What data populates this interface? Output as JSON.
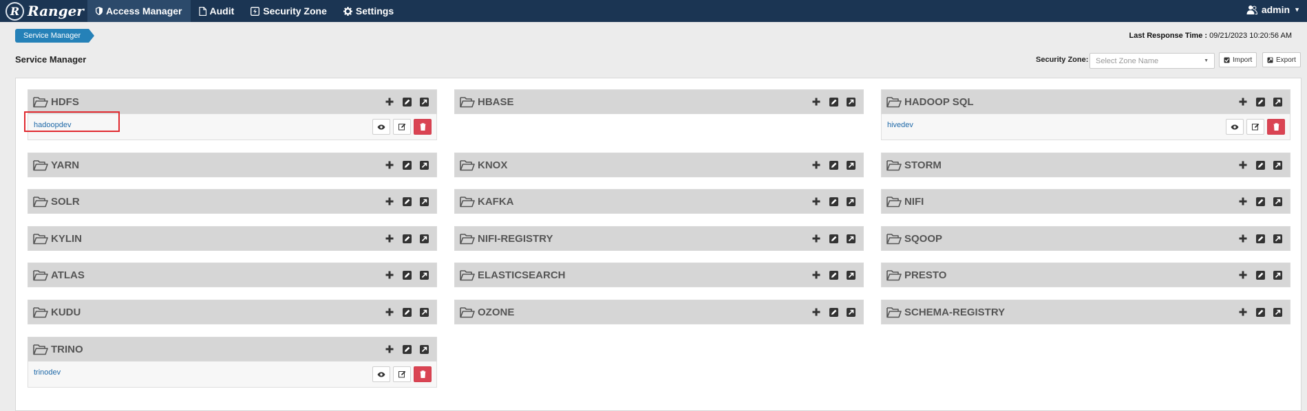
{
  "app": {
    "title": "Ranger",
    "logo_letter": "R"
  },
  "nav": [
    {
      "label": "Access Manager",
      "icon": "shield-icon",
      "active": true
    },
    {
      "label": "Audit",
      "icon": "file-icon",
      "active": false
    },
    {
      "label": "Security Zone",
      "icon": "zone-icon",
      "active": false
    },
    {
      "label": "Settings",
      "icon": "gear-icon",
      "active": false
    }
  ],
  "user": {
    "name": "admin",
    "icon": "users-icon"
  },
  "breadcrumb": "Service Manager",
  "last_response": {
    "label": "Last Response Time :",
    "value": "09/21/2023 10:20:56 AM"
  },
  "page_title": "Service Manager",
  "security_zone": {
    "label": "Security Zone:",
    "placeholder": "Select Zone Name"
  },
  "toolbar": {
    "import_label": "Import",
    "export_label": "Export"
  },
  "services": {
    "hdfs": {
      "name": "HDFS",
      "instances": [
        "hadoopdev"
      ]
    },
    "hbase": {
      "name": "HBASE",
      "instances": []
    },
    "hadoop_sql": {
      "name": "HADOOP SQL",
      "instances": [
        "hivedev"
      ]
    },
    "yarn": {
      "name": "YARN",
      "instances": []
    },
    "knox": {
      "name": "KNOX",
      "instances": []
    },
    "storm": {
      "name": "STORM",
      "instances": []
    },
    "solr": {
      "name": "SOLR",
      "instances": []
    },
    "kafka": {
      "name": "KAFKA",
      "instances": []
    },
    "nifi": {
      "name": "NIFI",
      "instances": []
    },
    "kylin": {
      "name": "KYLIN",
      "instances": []
    },
    "nifi_registry": {
      "name": "NIFI-REGISTRY",
      "instances": []
    },
    "sqoop": {
      "name": "SQOOP",
      "instances": []
    },
    "atlas": {
      "name": "ATLAS",
      "instances": []
    },
    "elasticsearch": {
      "name": "ELASTICSEARCH",
      "instances": []
    },
    "presto": {
      "name": "PRESTO",
      "instances": []
    },
    "kudu": {
      "name": "KUDU",
      "instances": []
    },
    "ozone": {
      "name": "OZONE",
      "instances": []
    },
    "schema_registry": {
      "name": "SCHEMA-REGISTRY",
      "instances": []
    },
    "trino": {
      "name": "TRINO",
      "instances": [
        "trinodev"
      ]
    }
  },
  "colors": {
    "nav_bg": "#1b3553",
    "accent": "#2581b8",
    "delete": "#da4453",
    "link": "#1f69a8",
    "highlight": "#e0282e"
  }
}
